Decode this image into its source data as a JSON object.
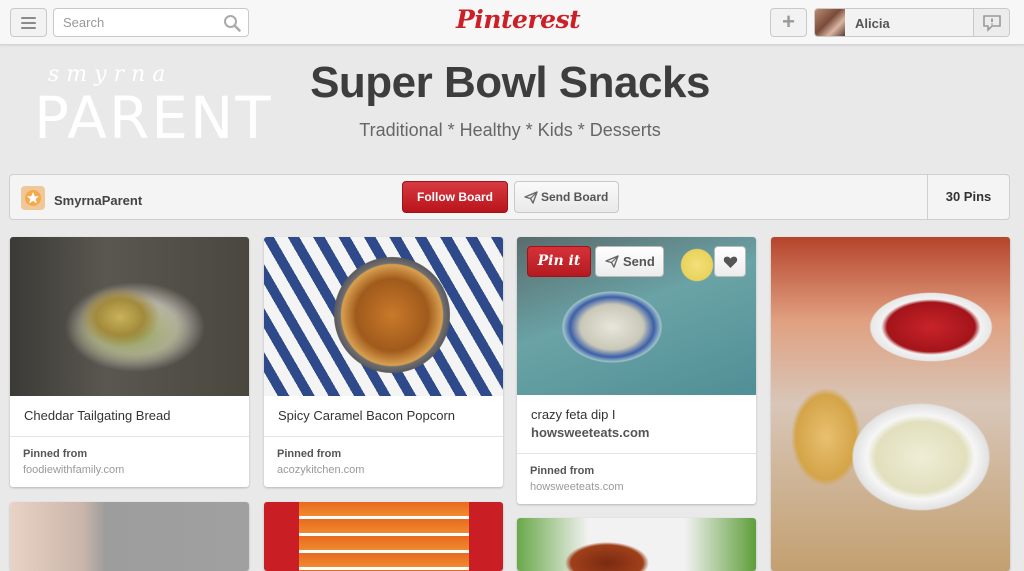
{
  "header": {
    "search_placeholder": "Search",
    "logo": "Pinterest",
    "add_label": "+",
    "user_name": "Alicia"
  },
  "brand": {
    "script_text": "smyrna",
    "big_text": "PARENT"
  },
  "board": {
    "title": "Super Bowl Snacks",
    "subtitle": "Traditional * Healthy * Kids * Desserts",
    "owner": "SmyrnaParent",
    "follow_label": "Follow Board",
    "send_label": "Send Board",
    "pins_count": "30 Pins"
  },
  "pins": [
    {
      "description": "Cheddar Tailgating Bread",
      "pinned_from_label": "Pinned from",
      "source": "foodiewithfamily.com"
    },
    {
      "description": "Spicy Caramel Bacon Popcorn",
      "pinned_from_label": "Pinned from",
      "source": "acozykitchen.com"
    },
    {
      "description": "crazy feta dip I",
      "description_link": "howsweeteats.com",
      "pinned_from_label": "Pinned from",
      "source": "howsweeteats.com",
      "pin_it_label": "Pin it",
      "send_label": "Send"
    }
  ],
  "colors": {
    "brand_red": "#cb2027",
    "background": "#e9e9e9"
  },
  "icons": [
    "menu-icon",
    "search-icon",
    "plus-icon",
    "notification-icon",
    "send-icon",
    "heart-icon"
  ]
}
